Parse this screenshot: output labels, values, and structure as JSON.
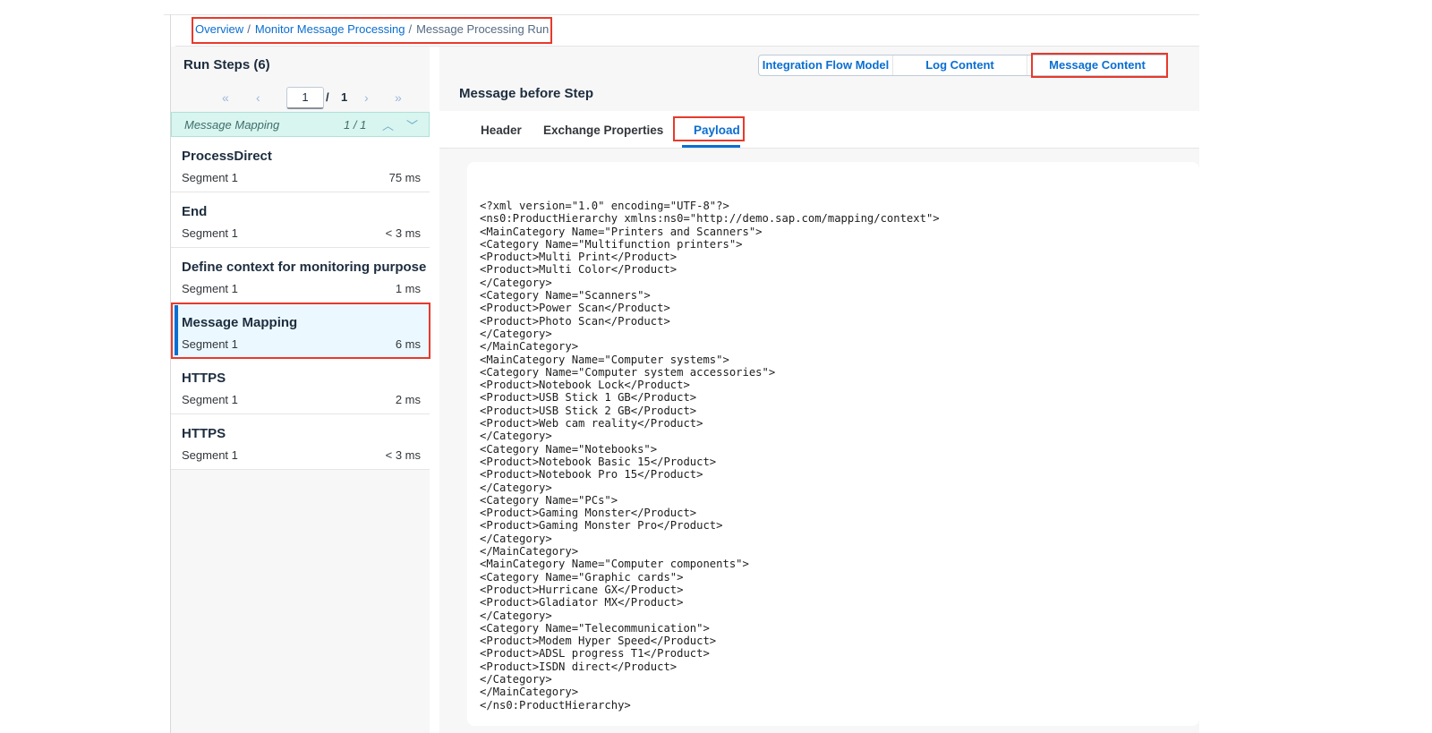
{
  "breadcrumb": {
    "items": [
      {
        "label": "Overview"
      },
      {
        "label": "Monitor Message Processing"
      }
    ],
    "separator": "/",
    "current": "Message Processing Run"
  },
  "left_panel": {
    "title": "Run Steps (6)",
    "pager": {
      "first": "«",
      "prev": "‹",
      "page": "1",
      "slash": "/",
      "total": "1",
      "next": "›",
      "last": "»"
    },
    "filter": {
      "label": "Message Mapping",
      "count": "1 / 1",
      "up": "︿",
      "down": "﹀"
    },
    "steps": [
      {
        "name": "ProcessDirect",
        "segment": "Segment 1",
        "duration": "75 ms"
      },
      {
        "name": "End",
        "segment": "Segment 1",
        "duration": "< 3 ms"
      },
      {
        "name": "Define context for monitoring purpose",
        "segment": "Segment 1",
        "duration": "1 ms"
      },
      {
        "name": "Message Mapping",
        "segment": "Segment 1",
        "duration": "6 ms"
      },
      {
        "name": "HTTPS",
        "segment": "Segment 1",
        "duration": "2 ms"
      },
      {
        "name": "HTTPS",
        "segment": "Segment 1",
        "duration": "< 3 ms"
      }
    ]
  },
  "right_panel": {
    "segments": [
      {
        "label": "Integration Flow Model"
      },
      {
        "label": "Log Content"
      },
      {
        "label": "Message Content"
      }
    ],
    "section_title": "Message before Step",
    "tabs": [
      {
        "label": "Header"
      },
      {
        "label": "Exchange Properties"
      },
      {
        "label": "Payload"
      }
    ],
    "payload": "<?xml version=\"1.0\" encoding=\"UTF-8\"?>\n<ns0:ProductHierarchy xmlns:ns0=\"http://demo.sap.com/mapping/context\">\n<MainCategory Name=\"Printers and Scanners\">\n<Category Name=\"Multifunction printers\">\n<Product>Multi Print</Product>\n<Product>Multi Color</Product>\n</Category>\n<Category Name=\"Scanners\">\n<Product>Power Scan</Product>\n<Product>Photo Scan</Product>\n</Category>\n</MainCategory>\n<MainCategory Name=\"Computer systems\">\n<Category Name=\"Computer system accessories\">\n<Product>Notebook Lock</Product>\n<Product>USB Stick 1 GB</Product>\n<Product>USB Stick 2 GB</Product>\n<Product>Web cam reality</Product>\n</Category>\n<Category Name=\"Notebooks\">\n<Product>Notebook Basic 15</Product>\n<Product>Notebook Pro 15</Product>\n</Category>\n<Category Name=\"PCs\">\n<Product>Gaming Monster</Product>\n<Product>Gaming Monster Pro</Product>\n</Category>\n</MainCategory>\n<MainCategory Name=\"Computer components\">\n<Category Name=\"Graphic cards\">\n<Product>Hurricane GX</Product>\n<Product>Gladiator MX</Product>\n</Category>\n<Category Name=\"Telecommunication\">\n<Product>Modem Hyper Speed</Product>\n<Product>ADSL progress T1</Product>\n<Product>ISDN direct</Product>\n</Category>\n</MainCategory>\n</ns0:ProductHierarchy>"
  },
  "colors": {
    "accent": "#0a6ed1",
    "highlight_box": "#e8392b",
    "selected_row": "#ebf8ff",
    "filter_bar": "#d9f5f0"
  }
}
